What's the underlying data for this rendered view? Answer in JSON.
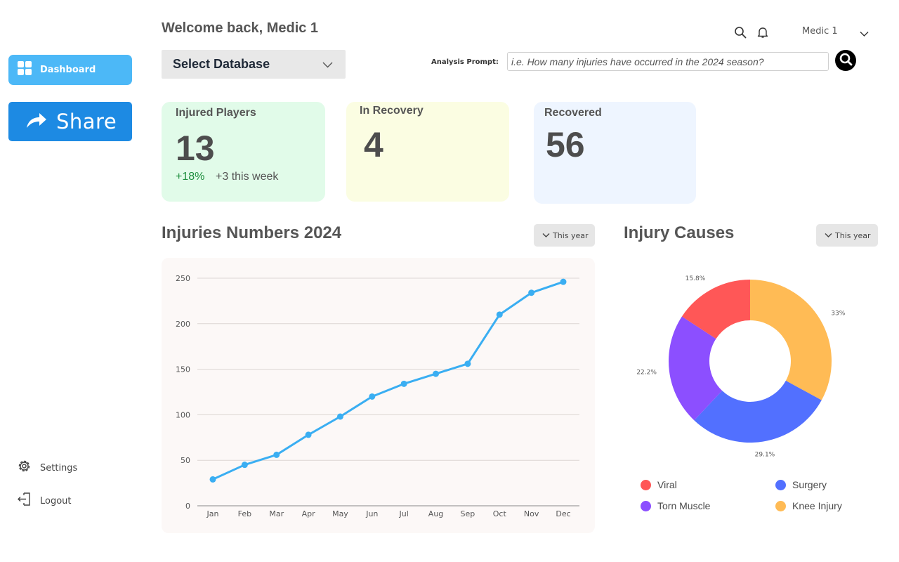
{
  "sidebar": {
    "dashboard_label": "Dashboard",
    "share_label": "Share",
    "settings_label": "Settings",
    "logout_label": "Logout"
  },
  "header": {
    "welcome": "Welcome back, Medic 1",
    "database_select": "Select Database",
    "prompt_label": "Analysis Prompt:",
    "prompt_placeholder": "i.e. How many injuries have occurred in the 2024 season?",
    "user_name": "Medic 1"
  },
  "stats": {
    "injured": {
      "title": "Injured Players",
      "value": "13",
      "delta": "+18%",
      "week": "+3 this week"
    },
    "recovery": {
      "title": "In Recovery",
      "value": "4"
    },
    "recovered": {
      "title": "Recovered",
      "value": "56"
    }
  },
  "line_section": {
    "title": "Injuries Numbers 2024",
    "filter": "This year"
  },
  "donut_section": {
    "title": "Injury Causes",
    "filter": "This year"
  },
  "colors": {
    "accent": "#4cb8f7",
    "share": "#1d8ae3",
    "line": "#3aaef2"
  },
  "chart_data": [
    {
      "type": "line",
      "title": "Injuries Numbers 2024",
      "x": [
        "Jan",
        "Feb",
        "Mar",
        "Apr",
        "May",
        "Jun",
        "Jul",
        "Aug",
        "Sep",
        "Oct",
        "Nov",
        "Dec"
      ],
      "series": [
        {
          "values": [
            29,
            45,
            56,
            78,
            98,
            120,
            134,
            145,
            156,
            210,
            234,
            246
          ],
          "color": "#3aaef2"
        }
      ],
      "yticks": [
        0,
        50,
        100,
        150,
        200,
        250
      ],
      "ylim": [
        0,
        250
      ],
      "grid": true
    },
    {
      "type": "pie",
      "title": "Injury Causes",
      "donut": true,
      "slices": [
        {
          "label": "Knee Injury",
          "value": 33,
          "value_label": "33%",
          "color": "#ffbb55"
        },
        {
          "label": "Surgery",
          "value": 29.1,
          "value_label": "29.1%",
          "color": "#5270ff"
        },
        {
          "label": "Torn Muscle",
          "value": 22.2,
          "value_label": "22.2%",
          "color": "#8c4fff"
        },
        {
          "label": "Viral",
          "value": 15.8,
          "value_label": "15.8%",
          "color": "#ff5757"
        }
      ],
      "legend": [
        {
          "label": "Viral",
          "color": "#ff5757"
        },
        {
          "label": "Surgery",
          "color": "#5270ff"
        },
        {
          "label": "Torn Muscle",
          "color": "#8c4fff"
        },
        {
          "label": "Knee Injury",
          "color": "#ffbb55"
        }
      ]
    }
  ]
}
